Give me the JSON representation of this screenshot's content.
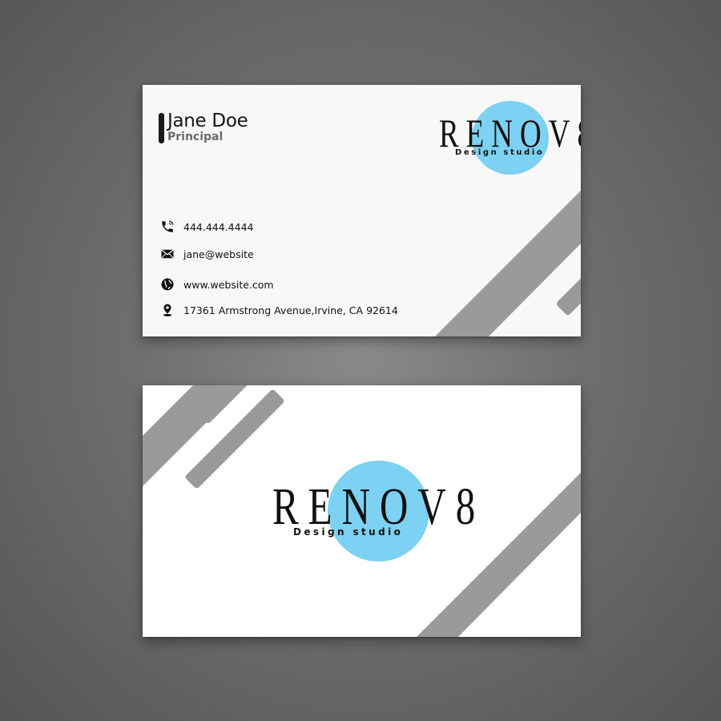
{
  "brand": {
    "wordmark": "RENOV8",
    "tagline": "Design studio",
    "circle_color": "#7dd1f2"
  },
  "front": {
    "name": "Jane Doe",
    "title": "Principal",
    "contacts": [
      {
        "icon": "phone-icon",
        "text": "444.444.4444"
      },
      {
        "icon": "mail-icon",
        "text": "jane@website"
      },
      {
        "icon": "globe-icon",
        "text": "www.website.com"
      },
      {
        "icon": "location-pin-icon",
        "text": "17361 Armstrong Avenue,Irvine, CA 92614"
      }
    ]
  },
  "colors": {
    "shape_gray": "#9a9a9a",
    "text_dark": "#111111"
  }
}
